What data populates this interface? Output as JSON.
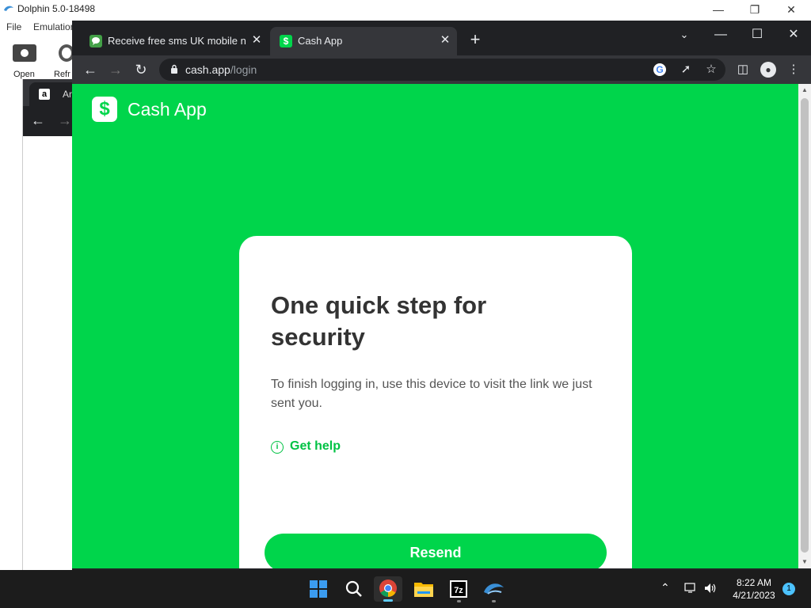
{
  "dolphin": {
    "title": "Dolphin 5.0-18498",
    "menu": [
      "File",
      "Emulation"
    ],
    "toolbar": [
      "Open",
      "Refr"
    ]
  },
  "background_browser": {
    "tab_label": "Ama"
  },
  "browser": {
    "tabs": [
      {
        "label": "Receive free sms UK mobile number",
        "favicon": "sms-icon"
      },
      {
        "label": "Cash App",
        "favicon": "cash-app-icon"
      }
    ],
    "new_tab_icon": "plus-icon",
    "url_host": "cash.app",
    "url_path": "/login"
  },
  "page": {
    "brand_logo": "$",
    "brand_name": "Cash App",
    "heading": "One quick step for security",
    "body": "To finish logging in, use this device to visit the link we just sent you.",
    "help_label": "Get help",
    "resend_label": "Resend"
  },
  "taskbar": {
    "icons": [
      "windows-start-icon",
      "search-icon",
      "chrome-icon",
      "file-explorer-icon",
      "7zip-icon",
      "dolphin-icon"
    ],
    "time": "8:22 AM",
    "date": "4/21/2023",
    "notification_count": "1"
  },
  "colors": {
    "cash_green": "#00d54b",
    "chrome_dark": "#202124",
    "chrome_toolbar": "#35363a",
    "taskbar": "#1c1c1c"
  }
}
